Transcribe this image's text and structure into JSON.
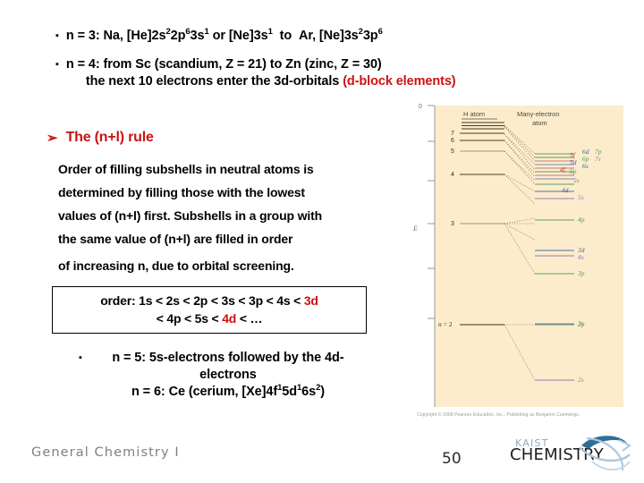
{
  "slide": {
    "bullets": [
      {
        "marker": "▪",
        "id": "n3",
        "html_segments": [
          {
            "t": "n = 3:  Na, [He]2s"
          },
          {
            "sup": "2"
          },
          {
            "t": "2p"
          },
          {
            "sup": "6"
          },
          {
            "t": "3s"
          },
          {
            "sup": "1"
          },
          {
            "t": " or [Ne]3s"
          },
          {
            "sup": "1"
          },
          {
            "t": "  to  Ar, [Ne]3s"
          },
          {
            "sup": "2"
          },
          {
            "t": "3p"
          },
          {
            "sup": "6"
          }
        ],
        "plain": "n = 3:  Na, [He]2s22p63s1 or [Ne]3s1  to  Ar, [Ne]3s23p6"
      }
    ],
    "bullet_n4": {
      "marker": "▪",
      "line1": "n = 4: from Sc (scandium, Z = 21) to Zn (zinc, Z = 30)",
      "line2_plain": "the next 10 electrons enter the 3d-orbitals ",
      "line2_red": "(d-block elements)"
    },
    "nl_rule": {
      "arrow_marker": "➢",
      "heading": "The (n+l) rule",
      "paragraph_lines": [
        "Order of filling subshells in neutral atoms is",
        "determined by filling those with the lowest",
        "values of (n+l) first. Subshells in a group with",
        "the same value of (n+l) are filled in order",
        "of increasing n, due to orbital screening."
      ]
    },
    "order_box": {
      "line1_prefix": "order: 1s < 2s < 2p < 3s < 3p < 4s < ",
      "line1_red": "3d",
      "line2_prefix": "< 4p < 5s < ",
      "line2_red": "4d",
      "line2_suffix": " < …"
    },
    "bullet_n5": {
      "marker": "▪",
      "line1": "n = 5: 5s-electrons followed by the 4d-",
      "line2": "electrons"
    },
    "bullet_n6": {
      "prefix": "n = 6: Ce (cerium, [Xe]4f",
      "sup1": "1",
      "mid1": "5d",
      "sup2": "1",
      "mid2": "6s",
      "sup3": "2",
      "suffix": ")"
    },
    "footer": {
      "course": "General Chemistry I",
      "page_number": "50",
      "logo_top": "KAIST",
      "logo_main": "CHEMISTRY"
    },
    "colors": {
      "accent_red": "#cc1111",
      "diagram_bg": "#fceccc",
      "footer_gray": "#808080"
    }
  },
  "energy_diagram": {
    "title_left": "H atom",
    "title_right_line1": "Many-electron",
    "title_right_line2": "atom",
    "axis_label": "E",
    "axis_zero_label": "0",
    "copyright": "Copyright © 2008 Pearson Education, Inc., Publishing as Benjamin Cummings.",
    "h_atom_levels": [
      "7",
      "6",
      "5",
      "4",
      "3",
      "n = 2"
    ],
    "many_electron_labels": [
      "7p",
      "7s",
      "6d",
      "6p",
      "6s",
      "5f",
      "5d",
      "5p",
      "5s",
      "4f",
      "4d",
      "4p",
      "3d",
      "4s",
      "3p",
      "3s",
      "2p",
      "2s"
    ]
  }
}
